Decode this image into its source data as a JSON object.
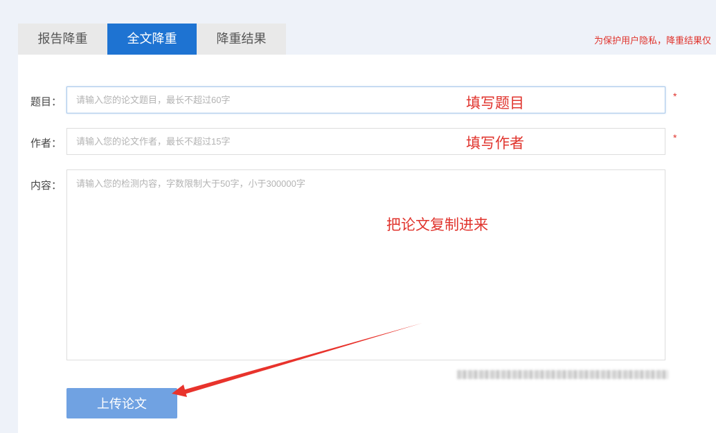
{
  "tabs": [
    {
      "label": "报告降重",
      "active": false
    },
    {
      "label": "全文降重",
      "active": true
    },
    {
      "label": "降重结果",
      "active": false
    }
  ],
  "privacy_note": "为保护用户隐私，降重结果仅",
  "form": {
    "title": {
      "label": "题目：",
      "placeholder": "请输入您的论文题目，最长不超过60字",
      "required_mark": "*"
    },
    "author": {
      "label": "作者：",
      "placeholder": "请输入您的论文作者，最长不超过15字",
      "required_mark": "*"
    },
    "content": {
      "label": "内容：",
      "placeholder": "请输入您的检测内容，字数限制大于50字，小于300000字"
    }
  },
  "annotations": {
    "title": "填写题目",
    "author": "填写作者",
    "content": "把论文复制进来"
  },
  "upload_button": "上传论文",
  "colors": {
    "accent": "#1e73d2",
    "button": "#70a2e2",
    "annotation": "#e0332c",
    "background": "#eef2f9"
  }
}
